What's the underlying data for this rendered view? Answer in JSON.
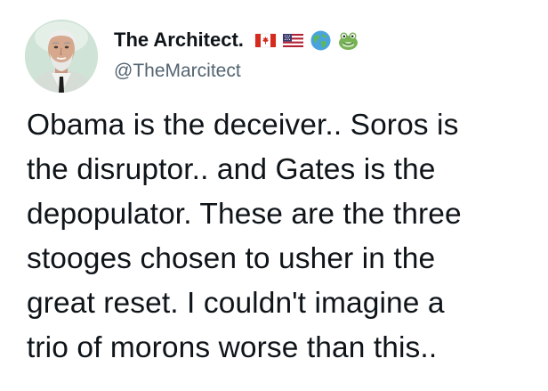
{
  "author": {
    "display_name": "The Architect.",
    "handle": "@TheMarcitect",
    "badges": [
      "canada-flag-icon",
      "us-flag-icon",
      "globe-icon",
      "frog-icon"
    ]
  },
  "tweet": {
    "lines": [
      "Obama is the deceiver.. Soros is",
      "the disruptor.. and Gates is the",
      "depopulator. These are the three",
      "stooges chosen to usher in the",
      "great reset. I couldn't imagine a",
      "trio of morons worse than this.."
    ]
  },
  "colors": {
    "text": "#0f1419",
    "handle": "#536471",
    "background": "#ffffff"
  }
}
